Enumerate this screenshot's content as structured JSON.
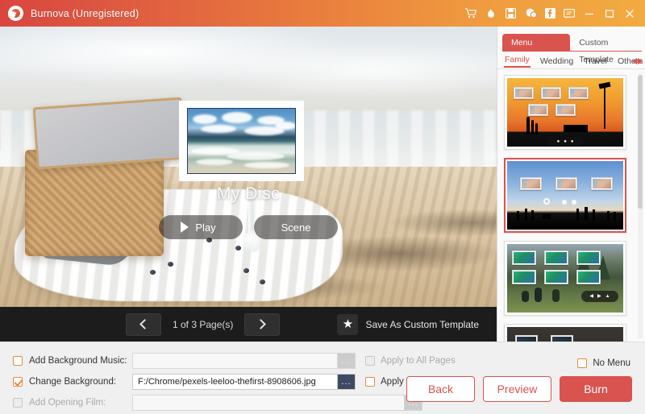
{
  "titlebar": {
    "app_title": "Burnova (Unregistered)",
    "logo_icon": "burnova-logo-icon",
    "icons": [
      {
        "name": "cart-icon",
        "label": "Cart"
      },
      {
        "name": "flame-icon",
        "label": "Burn"
      },
      {
        "name": "save-icon",
        "label": "Save"
      },
      {
        "name": "chat-icon",
        "label": "Support"
      },
      {
        "name": "facebook-icon",
        "label": "f"
      },
      {
        "name": "feedback-icon",
        "label": "Feedback"
      },
      {
        "name": "minimize-icon",
        "label": "Minimize"
      },
      {
        "name": "maximize-icon",
        "label": "Maximize"
      },
      {
        "name": "close-icon",
        "label": "Close"
      }
    ],
    "accent_left": "#d9453e",
    "accent_right": "#f2ab40"
  },
  "preview": {
    "disc_title": "My Disc",
    "play_label": "Play",
    "scene_label": "Scene",
    "background_description": "beach picnic with wicker basket on white cloth",
    "stamp_photo_description": "ocean waves under cloudy blue sky"
  },
  "pagebar": {
    "prev_label": "Previous page",
    "next_label": "Next page",
    "page_count": "1 of 3 Page(s)",
    "save_custom_label": "Save As Custom Template",
    "star_glyph": "★"
  },
  "templates": {
    "tabs": [
      {
        "label": "Menu Template",
        "active": true
      },
      {
        "label": "Custom Template",
        "active": false
      }
    ],
    "subtabs": [
      {
        "label": "Family",
        "active": true
      },
      {
        "label": "Wedding",
        "active": false
      },
      {
        "label": "Travel",
        "active": false
      },
      {
        "label": "Others",
        "active": false
      }
    ],
    "items": [
      {
        "name": "template-sunset-family",
        "selected": false
      },
      {
        "name": "template-beach-silhouette",
        "selected": true
      },
      {
        "name": "template-forest-camp",
        "selected": false
      },
      {
        "name": "template-dark-gold",
        "selected": false
      }
    ],
    "selected_accent": "#d9534f"
  },
  "options": {
    "rows": [
      {
        "label": "Add Background Music:",
        "checked": false,
        "disabled": false,
        "value": "",
        "browse_label": "...",
        "apply_label": "Apply to All Pages",
        "apply_checked": false,
        "apply_disabled": true
      },
      {
        "label": "Change Background:",
        "checked": true,
        "disabled": false,
        "value": "F:/Chrome/pexels-leeloo-thefirst-8908606.jpg",
        "browse_label": "...",
        "apply_label": "Apply to All Pages",
        "apply_checked": false,
        "apply_disabled": false
      },
      {
        "label": "Add Opening Film:",
        "checked": false,
        "disabled": true,
        "value": "",
        "browse_label": "...",
        "apply_label": "",
        "apply_checked": false,
        "apply_disabled": true
      }
    ],
    "no_menu_label": "No Menu",
    "no_menu_checked": false,
    "buttons": {
      "back": "Back",
      "preview": "Preview",
      "burn": "Burn"
    }
  }
}
